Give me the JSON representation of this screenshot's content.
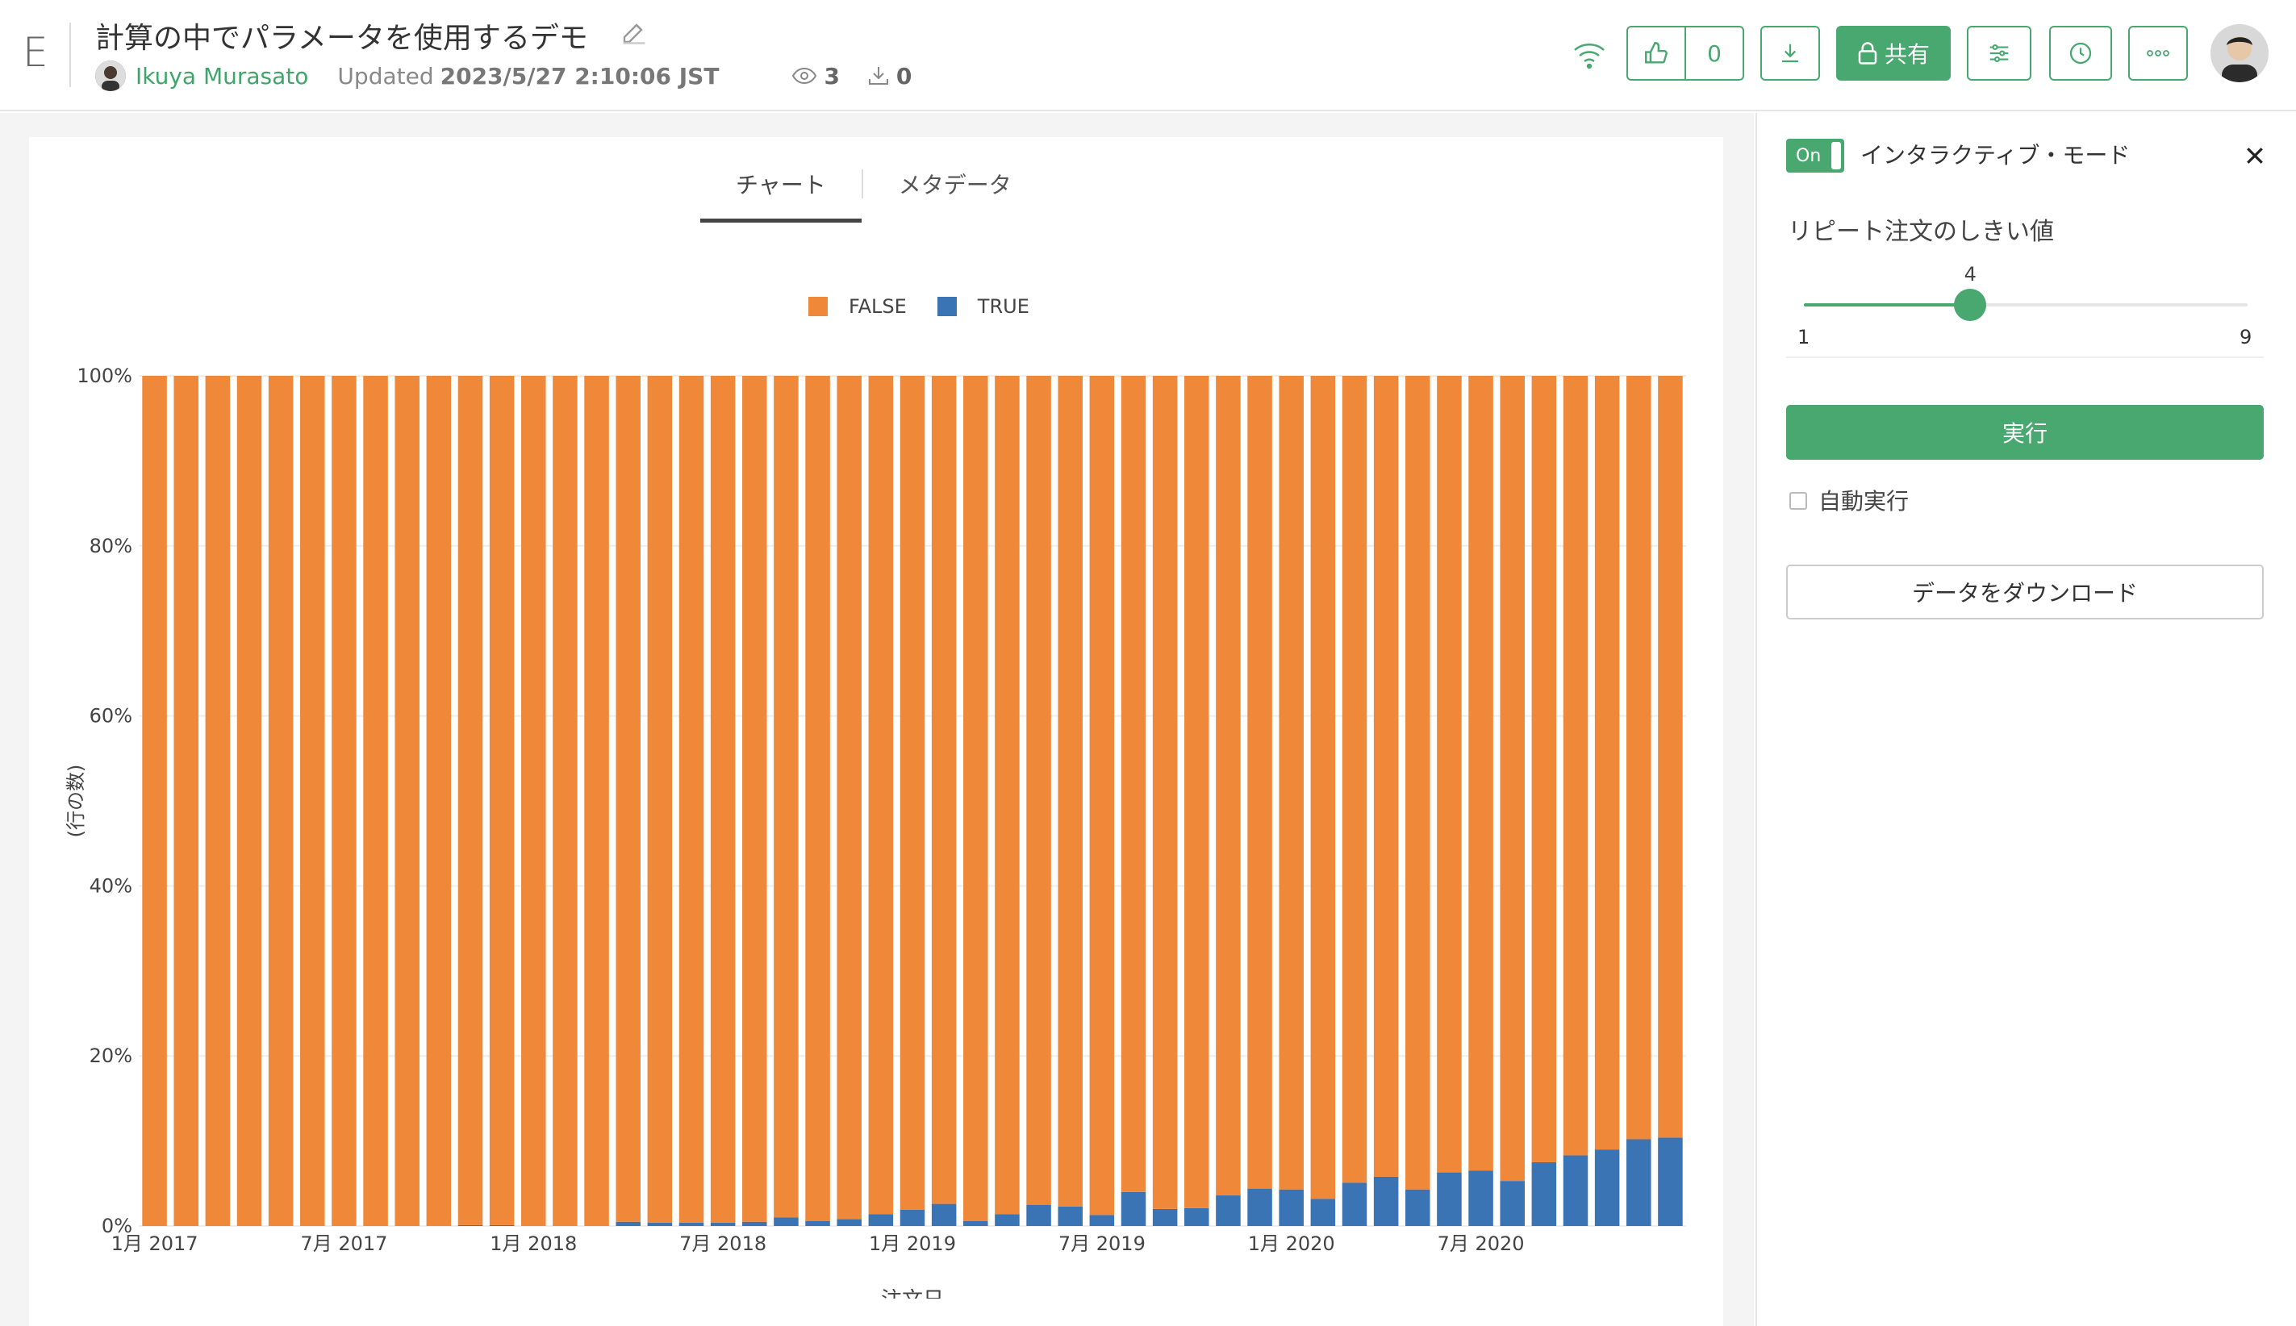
{
  "header": {
    "logo": "E",
    "title": "計算の中でパラメータを使用するデモ",
    "author": "Ikuya Murasato",
    "updated_label": "Updated",
    "updated_value": "2023/5/27 2:10:06 JST",
    "views": "3",
    "downloads": "0",
    "likes": "0",
    "share_label": "共有"
  },
  "tabs": [
    {
      "label": "チャート",
      "active": true
    },
    {
      "label": "メタデータ",
      "active": false
    }
  ],
  "panel": {
    "toggle_label": "On",
    "mode_label": "インタラクティブ・モード",
    "param_label": "リピート注文のしきい値",
    "slider": {
      "min": 1,
      "max": 9,
      "value": 4,
      "min_label": "1",
      "max_label": "9",
      "value_label": "4"
    },
    "run_label": "実行",
    "auto_label": "自動実行",
    "download_label": "データをダウンロード"
  },
  "colors": {
    "accent": "#48a870",
    "false_series": "#f0883a",
    "true_series": "#3b74b4"
  },
  "chart_data": {
    "type": "bar",
    "stacked": "percent",
    "xlabel": "注文日",
    "ylabel": "(行の数)",
    "ylim": [
      0,
      100
    ],
    "yticks": [
      "0%",
      "20%",
      "40%",
      "60%",
      "80%",
      "100%"
    ],
    "xticks": [
      {
        "index": 0,
        "label": "1月 2017"
      },
      {
        "index": 6,
        "label": "7月 2017"
      },
      {
        "index": 12,
        "label": "1月 2018"
      },
      {
        "index": 18,
        "label": "7月 2018"
      },
      {
        "index": 24,
        "label": "1月 2019"
      },
      {
        "index": 30,
        "label": "7月 2019"
      },
      {
        "index": 36,
        "label": "1月 2020"
      },
      {
        "index": 42,
        "label": "7月 2020"
      }
    ],
    "legend": [
      "FALSE",
      "TRUE"
    ],
    "legend_position": "top-center",
    "grid": true,
    "series": [
      {
        "name": "TRUE",
        "values": [
          0,
          0,
          0,
          0,
          0,
          0,
          0,
          0,
          0,
          0,
          0.1,
          0.1,
          0,
          0,
          0,
          0.5,
          0.4,
          0.4,
          0.4,
          0.5,
          1.0,
          0.6,
          0.8,
          1.4,
          1.9,
          2.6,
          0.6,
          1.4,
          2.5,
          2.3,
          1.3,
          4.0,
          2.0,
          2.1,
          3.6,
          4.4,
          4.3,
          3.2,
          5.1,
          5.8,
          4.3,
          6.3,
          6.5,
          5.3,
          7.5,
          8.3,
          9.0,
          10.2,
          10.4
        ]
      },
      {
        "name": "FALSE",
        "values": [
          100,
          100,
          100,
          100,
          100,
          100,
          100,
          100,
          100,
          100,
          99.9,
          99.9,
          100,
          100,
          100,
          99.5,
          99.6,
          99.6,
          99.6,
          99.5,
          99.0,
          99.4,
          99.2,
          98.6,
          98.1,
          97.4,
          99.4,
          98.6,
          97.5,
          97.7,
          98.7,
          96.0,
          98.0,
          97.9,
          96.4,
          95.6,
          95.7,
          96.8,
          94.9,
          94.2,
          95.7,
          93.7,
          93.5,
          94.7,
          92.5,
          91.7,
          91.0,
          89.8,
          89.6
        ]
      }
    ]
  }
}
